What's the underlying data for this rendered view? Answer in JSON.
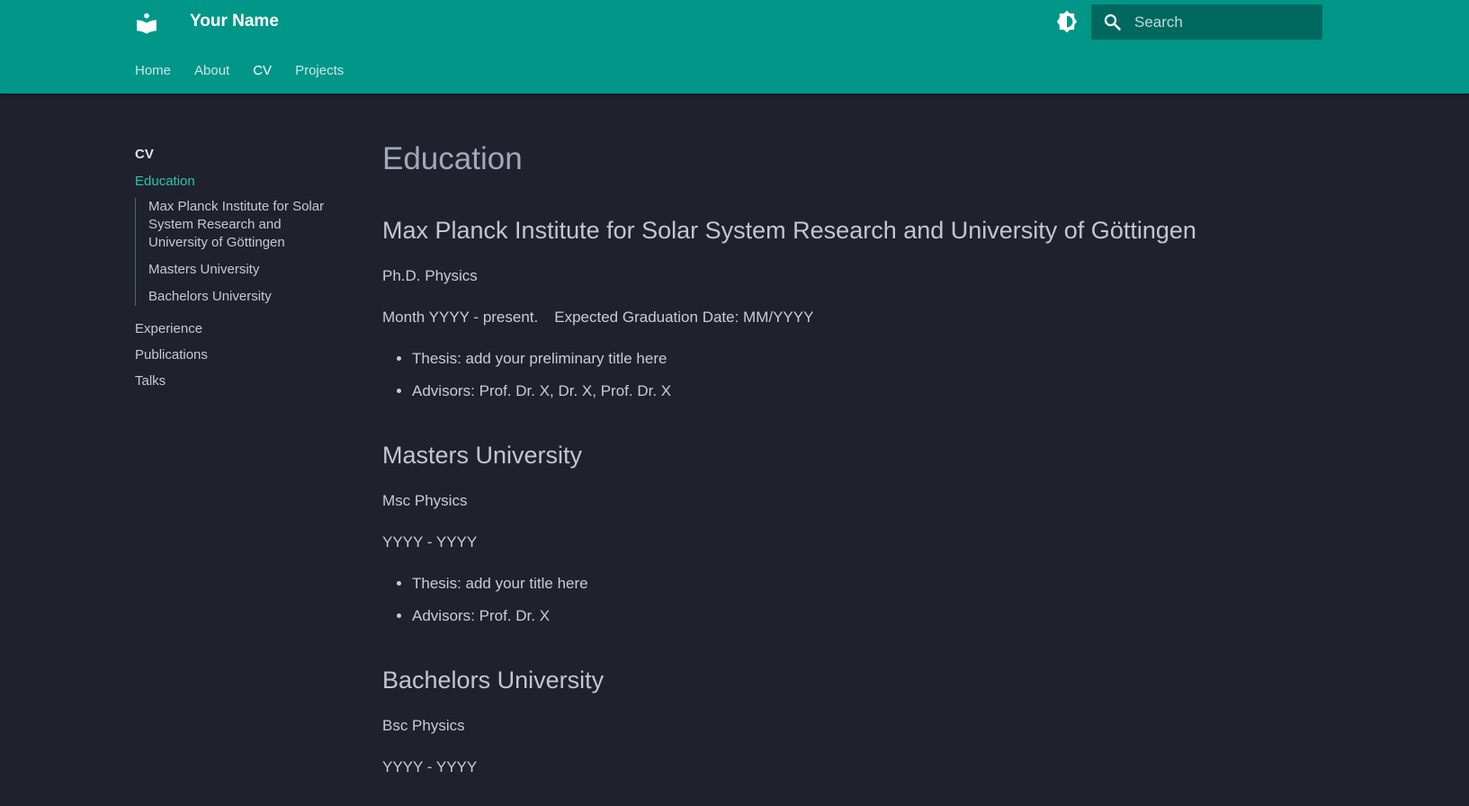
{
  "header": {
    "site_title": "Your Name",
    "logo_icon": "book-icon",
    "theme_toggle_icon": "brightness-icon",
    "search": {
      "icon": "search-icon",
      "placeholder": "Search"
    },
    "tabs": [
      {
        "label": "Home",
        "active": false
      },
      {
        "label": "About",
        "active": false
      },
      {
        "label": "CV",
        "active": true
      },
      {
        "label": "Projects",
        "active": false
      }
    ],
    "colors": {
      "primary": "#009688",
      "search_bg": "#00695f",
      "accent": "#2ec4b0",
      "background": "#1f222d"
    }
  },
  "sidebar": {
    "title": "CV",
    "active_item": "Education",
    "toc": [
      "Max Planck Institute for Solar System Research and University of Göttingen",
      "Masters University",
      "Bachelors University"
    ],
    "items": [
      "Experience",
      "Publications",
      "Talks"
    ]
  },
  "main": {
    "page_title": "Education",
    "sections": [
      {
        "title": "Max Planck Institute for Solar System Research and University of Göttingen",
        "degree": "Ph.D. Physics",
        "dates": "Month YYYY - present.",
        "expected": "Expected Graduation Date: MM/YYYY",
        "bullets": [
          "Thesis: add your preliminary title here",
          "Advisors: Prof. Dr. X, Dr. X, Prof. Dr. X"
        ]
      },
      {
        "title": "Masters University",
        "degree": "Msc Physics",
        "dates": "YYYY - YYYY",
        "bullets": [
          "Thesis: add your title here",
          "Advisors: Prof. Dr. X"
        ]
      },
      {
        "title": "Bachelors University",
        "degree": "Bsc Physics",
        "dates": "YYYY - YYYY"
      }
    ]
  }
}
